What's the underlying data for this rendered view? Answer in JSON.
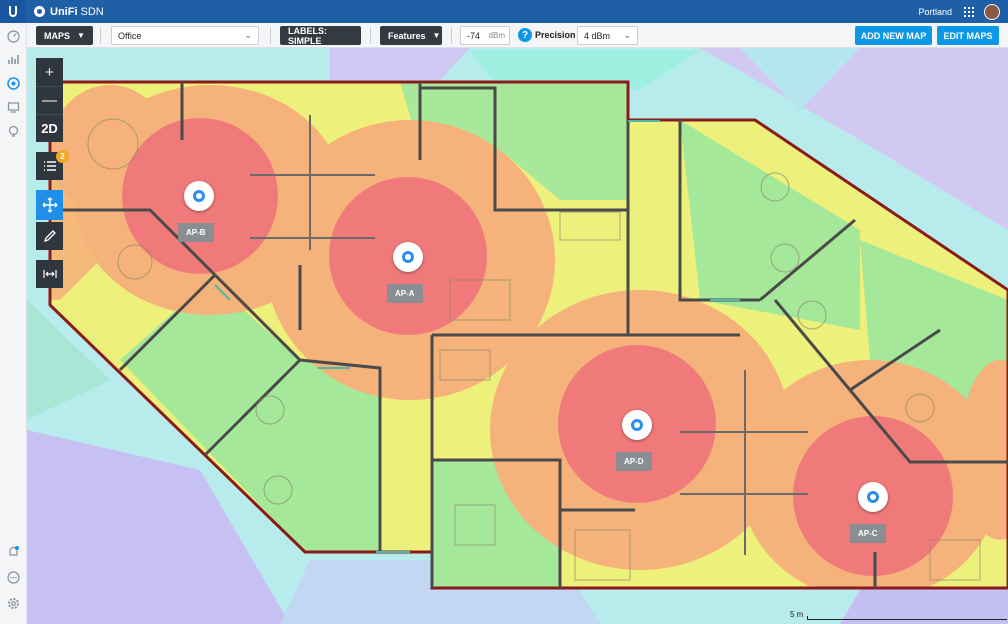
{
  "topbar": {
    "brand": "UniFi",
    "brand_suffix": "SDN",
    "site": "Portland"
  },
  "toolbar": {
    "maps_label": "MAPS",
    "map_select": "Office",
    "labels_button": "LABELS: SIMPLE",
    "features_button": "Features",
    "dbm_value": "-74",
    "dbm_unit": "dBm",
    "help_glyph": "?",
    "precision_label": "Precision",
    "precision_value": "4 dBm",
    "add_map": "ADD NEW MAP",
    "edit_maps": "EDIT MAPS"
  },
  "map_tools": {
    "zoom_in": "+",
    "zoom_out": "—",
    "view_mode": "2D",
    "list_badge": "2"
  },
  "access_points": [
    {
      "label": "AP-B"
    },
    {
      "label": "AP-A"
    },
    {
      "label": "AP-D"
    },
    {
      "label": "AP-C"
    }
  ],
  "scale_label": "5 m",
  "sidebar_icons": [
    "dashboard-icon",
    "statistics-icon",
    "map-icon",
    "devices-icon",
    "insights-icon",
    "alerts-icon",
    "events-icon",
    "settings-icon"
  ],
  "heatmap_colors": {
    "strong": "#f07a7a",
    "good": "#f5b27a",
    "fair": "#eef07c",
    "weak": "#a6e89a",
    "poor": "#8ff0dc",
    "none": "#c9bdf2"
  }
}
